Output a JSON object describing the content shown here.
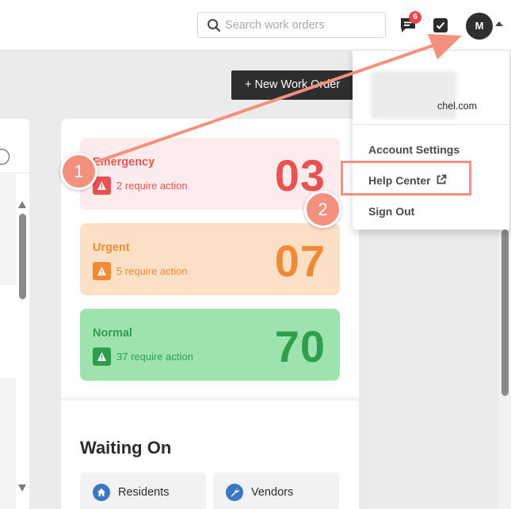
{
  "header": {
    "search_placeholder": "Search work orders",
    "messages_badge": "6",
    "avatar_initial": "M"
  },
  "toolbar": {
    "new_work_order_label": "+ New Work Order"
  },
  "priorities": [
    {
      "title": "Emergency",
      "action_text": "2 require action",
      "count": "03",
      "color": "#e85252"
    },
    {
      "title": "Urgent",
      "action_text": "5 require action",
      "count": "07",
      "color": "#ef8a36"
    },
    {
      "title": "Normal",
      "action_text": "37 require action",
      "count": "70",
      "color": "#2e9e4c"
    }
  ],
  "waiting_on": {
    "title": "Waiting On",
    "buttons": [
      {
        "label": "Residents",
        "icon": "home-icon"
      },
      {
        "label": "Vendors",
        "icon": "wrench-icon"
      }
    ]
  },
  "user_menu": {
    "email_visible": "chel.com",
    "items": [
      {
        "label": "Account Settings"
      },
      {
        "label": "Help Center",
        "icon": "external-link-icon"
      },
      {
        "label": "Sign Out"
      }
    ]
  },
  "annotations": {
    "step_1": "1",
    "step_2": "2",
    "accent_color": "#f4907e"
  }
}
